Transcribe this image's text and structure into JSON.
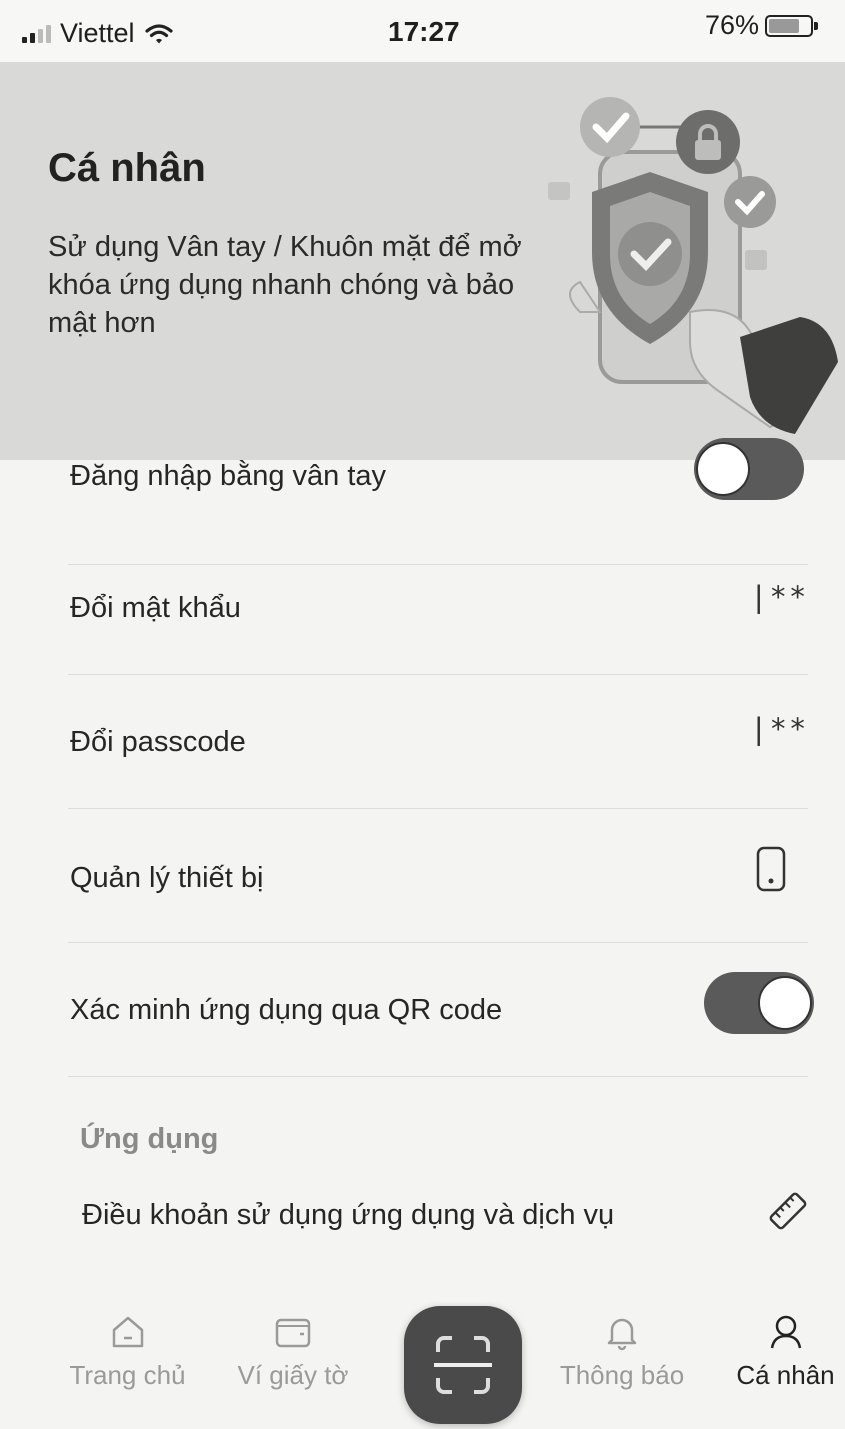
{
  "status_bar": {
    "carrier": "Viettel",
    "time": "17:27",
    "battery_percent": "76%",
    "battery_level": 0.76
  },
  "hero": {
    "title": "Cá nhân",
    "description": "Sử dụng Vân tay / Khuôn mặt để mở  khóa ứng dụng nhanh chóng và bảo mật hơn",
    "illustration_icon": "security-shield-phone-icon"
  },
  "settings": {
    "items": [
      {
        "label": "Đăng nhập bằng vân tay",
        "control": "toggle",
        "on": false
      },
      {
        "label": "Đổi mật khẩu",
        "control": "password-icon",
        "icon_text": "|**"
      },
      {
        "label": "Đổi passcode",
        "control": "password-icon",
        "icon_text": "|**"
      },
      {
        "label": "Quản lý thiết bị",
        "control": "phone-icon"
      },
      {
        "label": "Xác minh ứng dụng qua QR code",
        "control": "toggle",
        "on": true
      }
    ]
  },
  "app_section": {
    "header": "Ứng dụng",
    "terms_label": "Điều khoản sử dụng ứng dụng và dịch vụ",
    "terms_icon": "ruler-icon"
  },
  "tab_bar": {
    "tabs": [
      {
        "label": "Trang chủ",
        "icon": "home-icon",
        "active": false
      },
      {
        "label": "Ví giấy tờ",
        "icon": "wallet-icon",
        "active": false
      },
      {
        "label": "Thông báo",
        "icon": "bell-icon",
        "active": false
      },
      {
        "label": "Cá nhân",
        "icon": "user-icon",
        "active": true
      }
    ],
    "center_button_icon": "scan-qr-icon"
  },
  "colors": {
    "toggle_on": "#5a5a5a",
    "toggle_off_track": "#5a5a5a",
    "hero_background": "#d9d9d7",
    "section_header": "#8a8a8a"
  }
}
